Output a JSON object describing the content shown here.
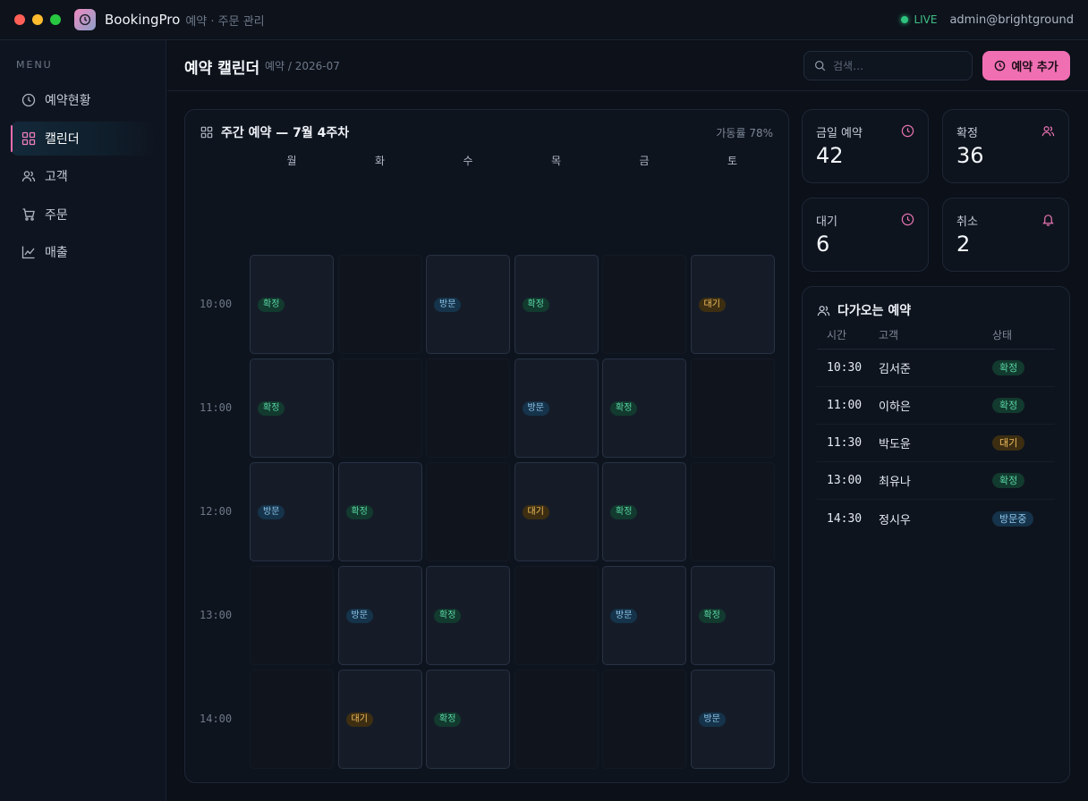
{
  "app": {
    "name": "BookingPro",
    "subtitle": "예약 · 주문 관리",
    "live_label": "LIVE",
    "user": "admin@brightground"
  },
  "sidebar": {
    "menu_title": "MENU",
    "items": [
      {
        "label": "예약현황",
        "icon": "clock-icon",
        "active": false
      },
      {
        "label": "캘린더",
        "icon": "grid-icon",
        "active": true
      },
      {
        "label": "고객",
        "icon": "users-icon",
        "active": false
      },
      {
        "label": "주문",
        "icon": "cart-icon",
        "active": false
      },
      {
        "label": "매출",
        "icon": "chart-icon",
        "active": false
      }
    ]
  },
  "header": {
    "title": "예약 캘린더",
    "breadcrumb": "예약 / 2026-07",
    "search_placeholder": "검색…",
    "add_button": "예약 추가"
  },
  "calendar": {
    "title": "주간 예약 — 7월 4주차",
    "utilization": "가동률 78%",
    "days": [
      "월",
      "화",
      "수",
      "목",
      "금",
      "토"
    ],
    "times": [
      "10:00",
      "11:00",
      "12:00",
      "13:00",
      "14:00"
    ],
    "grid": [
      [
        "확정",
        "",
        "방문",
        "확정",
        "",
        "대기"
      ],
      [
        "확정",
        "",
        "",
        "방문",
        "확정",
        ""
      ],
      [
        "방문",
        "확정",
        "",
        "대기",
        "확정",
        ""
      ],
      [
        "",
        "방문",
        "확정",
        "",
        "방문",
        "확정"
      ],
      [
        "",
        "대기",
        "확정",
        "",
        "",
        "방문"
      ]
    ]
  },
  "stats": {
    "today": {
      "label": "금일 예약",
      "value": "42",
      "icon": "clock-icon"
    },
    "confirmed": {
      "label": "확정",
      "value": "36",
      "icon": "users-icon"
    },
    "waiting": {
      "label": "대기",
      "value": "6",
      "icon": "clock-icon"
    },
    "cancelled": {
      "label": "취소",
      "value": "2",
      "icon": "bell-icon"
    }
  },
  "upcoming": {
    "title": "다가오는 예약",
    "headers": {
      "time": "시간",
      "customer": "고객",
      "status": "상태"
    },
    "rows": [
      {
        "time": "10:30",
        "customer": "김서준",
        "status": "확정",
        "kind": "confirm"
      },
      {
        "time": "11:00",
        "customer": "이하은",
        "status": "확정",
        "kind": "confirm"
      },
      {
        "time": "11:30",
        "customer": "박도윤",
        "status": "대기",
        "kind": "wait"
      },
      {
        "time": "13:00",
        "customer": "최유나",
        "status": "확정",
        "kind": "confirm"
      },
      {
        "time": "14:30",
        "customer": "정시우",
        "status": "방문중",
        "kind": "visit"
      }
    ]
  },
  "colors": {
    "accent": "#f06fb3",
    "confirm": "#58d3a2",
    "visit": "#8fc8ee",
    "wait": "#f2be5c",
    "live": "#2fc47e"
  }
}
